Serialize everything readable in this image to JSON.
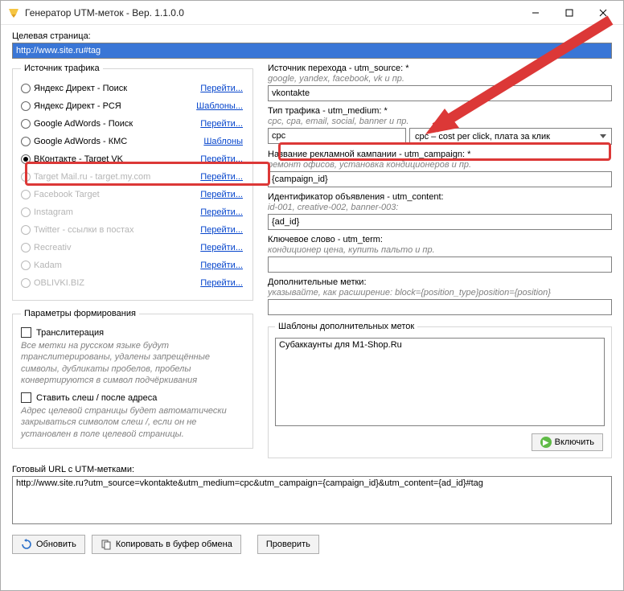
{
  "window": {
    "title": "Генератор UTM-меток - Вер. 1.1.0.0"
  },
  "target_page": {
    "label": "Целевая страница:",
    "value": "http://www.site.ru#tag"
  },
  "traffic_source_group": {
    "legend": "Источник трафика",
    "items": [
      {
        "label": "Яндекс Директ - Поиск",
        "link": "Перейти...",
        "enabled": true,
        "checked": false
      },
      {
        "label": "Яндекс Директ - РСЯ",
        "link": "Шаблоны...",
        "enabled": true,
        "checked": false
      },
      {
        "label": "Google AdWords - Поиск",
        "link": "Перейти...",
        "enabled": true,
        "checked": false
      },
      {
        "label": "Google AdWords - КМС",
        "link": "Шаблоны",
        "enabled": true,
        "checked": false
      },
      {
        "label": "ВКонтакте - Target VK",
        "link": "Перейти...",
        "enabled": true,
        "checked": true
      },
      {
        "label": "Target Mail.ru - target.my.com",
        "link": "Перейти...",
        "enabled": false,
        "checked": false
      },
      {
        "label": "Facebook Target",
        "link": "Перейти...",
        "enabled": false,
        "checked": false
      },
      {
        "label": "Instagram",
        "link": "Перейти...",
        "enabled": false,
        "checked": false
      },
      {
        "label": "Twitter - ссылки в постах",
        "link": "Перейти...",
        "enabled": false,
        "checked": false
      },
      {
        "label": "Recreativ",
        "link": "Перейти...",
        "enabled": false,
        "checked": false
      },
      {
        "label": "Kadam",
        "link": "Перейти...",
        "enabled": false,
        "checked": false
      },
      {
        "label": "OBLIVKI.BIZ",
        "link": "Перейти...",
        "enabled": false,
        "checked": false
      }
    ]
  },
  "params_group": {
    "legend": "Параметры формирования",
    "translit_label": "Транслитерация",
    "translit_hint": "Все метки на русском языке будут транслитерированы, удалены запрещённые символы, дубликаты пробелов, пробелы конвертируются в символ подчёркивания",
    "slash_label": "Ставить слеш / после адреса",
    "slash_hint": "Адрес целевой страницы будет автоматически закрываться символом слеш /, если он не установлен в поле целевой страницы."
  },
  "right": {
    "source": {
      "label": "Источник перехода - utm_source: *",
      "hint": "google, yandex, facebook, vk и пр.",
      "value": "vkontakte"
    },
    "medium": {
      "label": "Тип трафика - utm_medium: *",
      "hint": "cpc, cpa, email, social, banner и пр.",
      "value": "cpc",
      "select_value": "cpc – cost per click, плата за клик"
    },
    "campaign": {
      "label": "Название рекламной кампании - utm_campaign: *",
      "hint": "ремонт офисов, установка кондиционеров и пр.",
      "value": "{campaign_id}"
    },
    "content": {
      "label": "Идентификатор объявления - utm_content:",
      "hint": "id-001, creative-002, banner-003:",
      "value": "{ad_id}"
    },
    "term": {
      "label": "Ключевое слово - utm_term:",
      "hint": "кондиционер цена, купить пальто и пр.",
      "value": ""
    },
    "extra": {
      "label": "Дополнительные метки:",
      "hint": "указывайте, как расширение: block={position_type}position={position}",
      "value": ""
    },
    "templates": {
      "legend": "Шаблоны дополнительных меток",
      "value": "Субаккаунты для M1-Shop.Ru",
      "enable_label": "Включить"
    }
  },
  "ready_url": {
    "label": "Готовый URL с UTM-метками:",
    "value": "http://www.site.ru?utm_source=vkontakte&utm_medium=cpc&utm_campaign={campaign_id}&utm_content={ad_id}#tag"
  },
  "buttons": {
    "refresh": "Обновить",
    "copy": "Копировать в буфер обмена",
    "check": "Проверить"
  }
}
